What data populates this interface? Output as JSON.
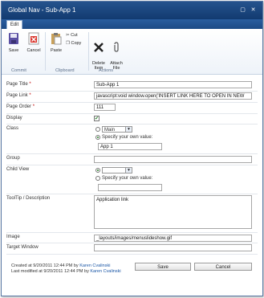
{
  "window": {
    "title": "Global Nav - Sub-App 1"
  },
  "tabs": {
    "edit": "Edit"
  },
  "ribbon": {
    "save": "Save",
    "cancel": "Cancel",
    "paste": "Paste",
    "cut": "Cut",
    "copy": "Copy",
    "delete_item": "Delete\nItem",
    "attach_file": "Attach\nFile",
    "group_commit": "Commit",
    "group_clipboard": "Clipboard",
    "group_actions": "Actions"
  },
  "form": {
    "page_title": {
      "label": "Page Title",
      "value": "Sub-App 1"
    },
    "page_link": {
      "label": "Page Link",
      "value": "javascript:void window.open('INSERT LINK HERE TO OPEN IN NEW"
    },
    "page_order": {
      "label": "Page Order",
      "value": "111"
    },
    "display": {
      "label": "Display",
      "checked": true
    },
    "class": {
      "label": "Class",
      "select_value": "Main",
      "specify_label": "Specify your own value:",
      "own_value": "App 1"
    },
    "group": {
      "label": "Group",
      "value": ""
    },
    "child_view": {
      "label": "Child View",
      "select_value": "",
      "specify_label": "Specify your own value:",
      "own_value": ""
    },
    "tooltip": {
      "label": "ToolTip / Description",
      "value": "Application link"
    },
    "image": {
      "label": "Image",
      "value": "_layouts/images/menuslideshow.gif"
    },
    "target_window": {
      "label": "Target Window",
      "value": ""
    },
    "required_mark": "*"
  },
  "footer": {
    "created_prefix": "Created at 9/20/2011 12:44 PM  by",
    "created_by": "Karen Cvalinski",
    "modified_prefix": "Last modified at 9/20/2011 12:44 PM  by",
    "modified_by": "Karen Cvalinski",
    "save": "Save",
    "cancel": "Cancel"
  }
}
